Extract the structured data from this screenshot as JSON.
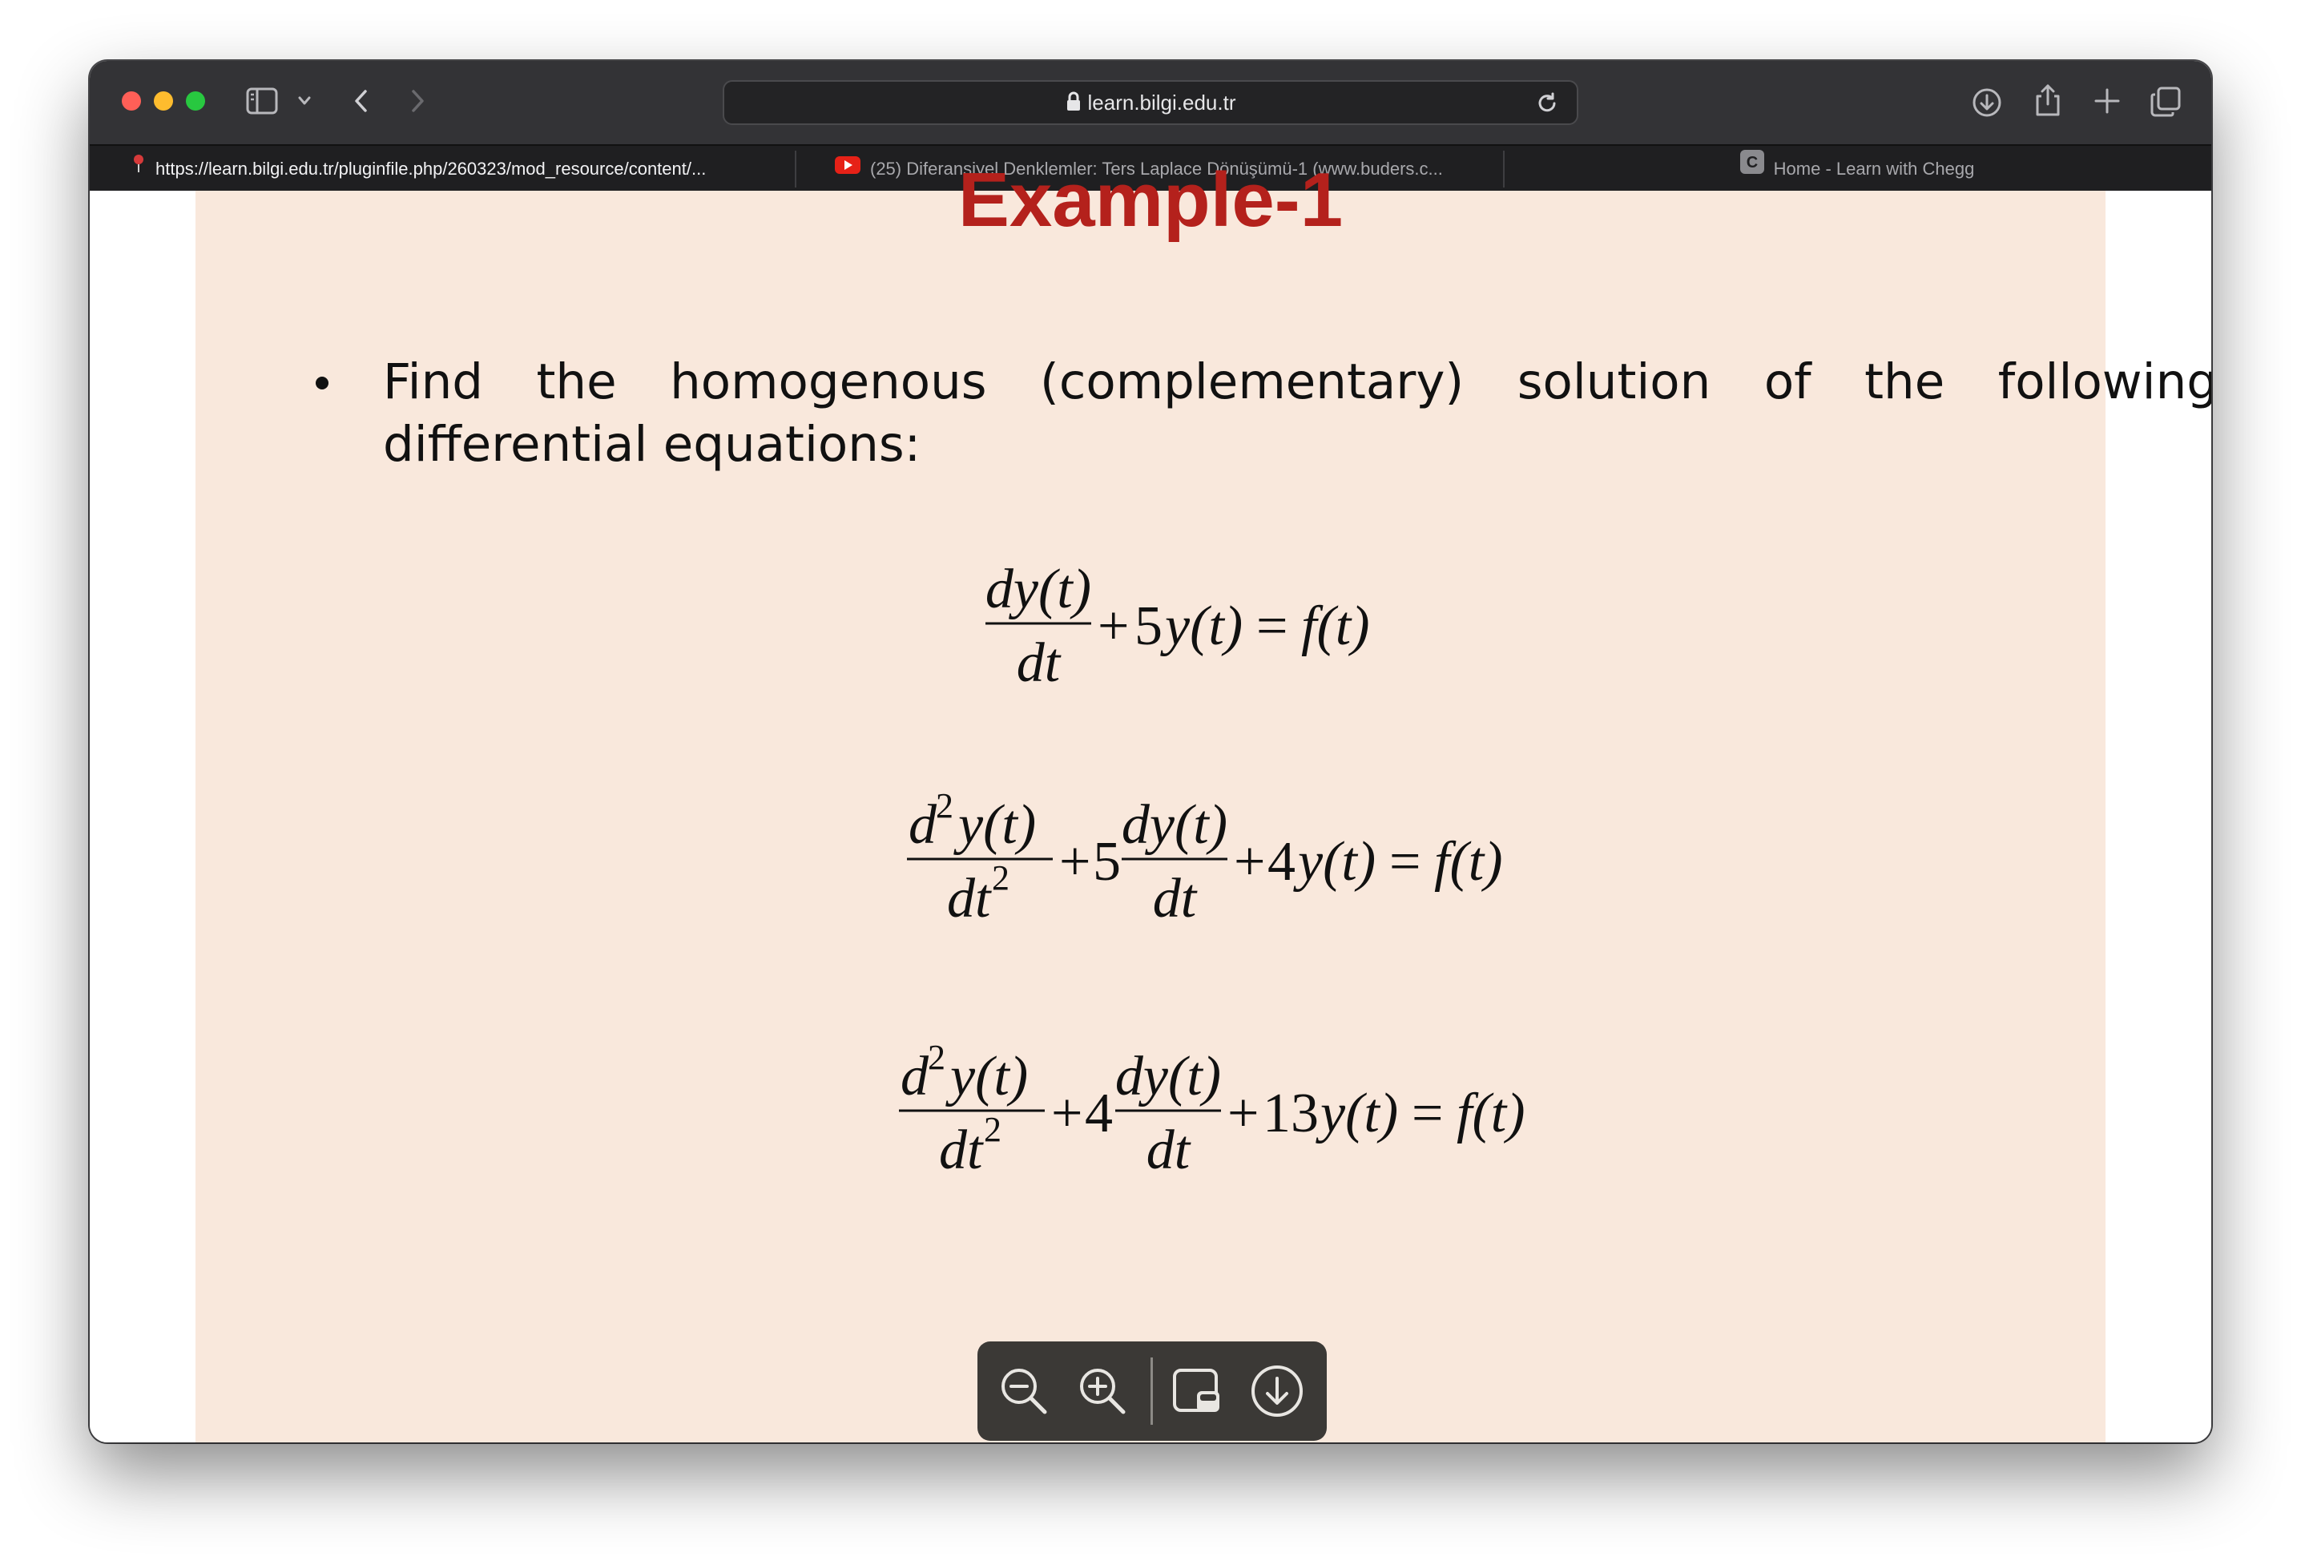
{
  "browser": {
    "address": "learn.bilgi.edu.tr",
    "tabs": [
      {
        "title": "https://learn.bilgi.edu.tr/pluginfile.php/260323/mod_resource/content/...",
        "favicon": "pin-icon",
        "active": true
      },
      {
        "title": "(25) Diferansiyel Denklemler: Ters Laplace Dönüşümü-1 (www.buders.c...",
        "favicon": "youtube-icon",
        "active": false
      },
      {
        "title": "Home - Learn with Chegg",
        "favicon": "chegg-icon",
        "favicon_letter": "C",
        "active": false
      }
    ],
    "colors": {
      "toolbar": "#333336",
      "tabbar": "#1f1f21"
    }
  },
  "slide": {
    "title": "Example-1",
    "bullet": "Find the homogenous (complementary) solution of the following differential equations:",
    "equations": [
      {
        "parts": [
          "dy(t)",
          "dt",
          "+",
          "5",
          "y(t)",
          "=",
          "f(t)"
        ],
        "latex": "\\frac{dy(t)}{dt}+5y(t)=f(t)"
      },
      {
        "parts": [
          "d",
          "2",
          "y(t)",
          "dt",
          "2",
          "+",
          "5",
          "dy(t)",
          "dt",
          "+",
          "4",
          "y(t)",
          "=",
          "f(t)"
        ],
        "latex": "\\frac{d^2y(t)}{dt^2}+5\\frac{dy(t)}{dt}+4y(t)=f(t)"
      },
      {
        "parts": [
          "d",
          "2",
          "y(t)",
          "dt",
          "2",
          "+",
          "4",
          "dy(t)",
          "dt",
          "+",
          "13",
          "y(t)",
          "=",
          "f(t)"
        ],
        "latex": "\\frac{d^2y(t)}{dt^2}+4\\frac{dy(t)}{dt}+13y(t)=f(t)"
      }
    ],
    "colors": {
      "background": "#f9e8dc",
      "title": "#b4211c"
    }
  },
  "pdf_toolbar": {
    "buttons": [
      "zoom-out-icon",
      "zoom-in-icon",
      "sidebar-thumbnail-icon",
      "download-icon"
    ]
  }
}
